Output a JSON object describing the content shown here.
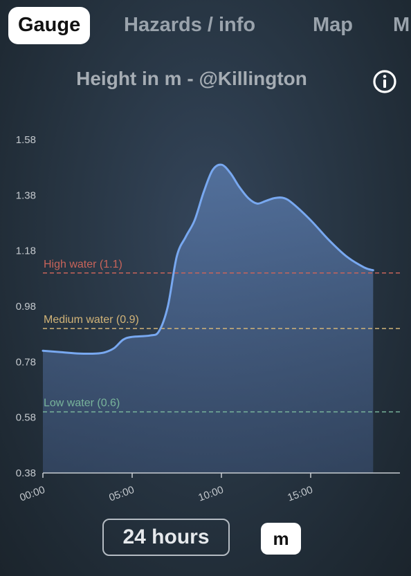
{
  "tabs": [
    {
      "label": "Gauge",
      "active": true
    },
    {
      "label": "Hazards / info",
      "active": false
    },
    {
      "label": "Map",
      "active": false
    },
    {
      "label": "M",
      "active": false
    }
  ],
  "title": "Height in m - @Killington",
  "controls": {
    "range_label": "24 hours",
    "unit_label": "m"
  },
  "colors": {
    "line": "#78a8f0",
    "high": "#c8645a",
    "medium": "#d2b478",
    "low": "#78b49b"
  },
  "chart_data": {
    "type": "area",
    "title": "Height in m - @Killington",
    "xlabel": "",
    "ylabel": "",
    "ylim": [
      0.38,
      1.58
    ],
    "xlim": [
      "00:00",
      "20:00"
    ],
    "y_ticks": [
      "1.58",
      "1.38",
      "1.18",
      "0.98",
      "0.78",
      "0.58",
      "0.38"
    ],
    "x_ticks": [
      "00:00",
      "05:00",
      "10:00",
      "15:00"
    ],
    "thresholds": [
      {
        "label": "High water (1.1)",
        "value": 1.1,
        "color_key": "high"
      },
      {
        "label": "Medium water (0.9)",
        "value": 0.9,
        "color_key": "medium"
      },
      {
        "label": "Low water (0.6)",
        "value": 0.6,
        "color_key": "low"
      }
    ],
    "series": [
      {
        "x": [
          "00:00",
          "01:00",
          "02:00",
          "03:00",
          "03:30",
          "04:00",
          "04:30",
          "05:00",
          "06:00",
          "06:30",
          "07:00",
          "07:30",
          "08:00",
          "08:30",
          "09:00",
          "09:30",
          "10:00",
          "10:30",
          "11:00",
          "11:30",
          "12:00",
          "12:30",
          "13:00",
          "13:30",
          "14:00",
          "15:00",
          "16:00",
          "17:00",
          "18:00",
          "18:30"
        ],
        "values": [
          0.82,
          0.815,
          0.81,
          0.81,
          0.815,
          0.83,
          0.86,
          0.87,
          0.875,
          0.89,
          0.98,
          1.16,
          1.23,
          1.29,
          1.39,
          1.47,
          1.49,
          1.46,
          1.41,
          1.37,
          1.35,
          1.36,
          1.37,
          1.37,
          1.35,
          1.29,
          1.22,
          1.16,
          1.12,
          1.11
        ]
      }
    ]
  }
}
